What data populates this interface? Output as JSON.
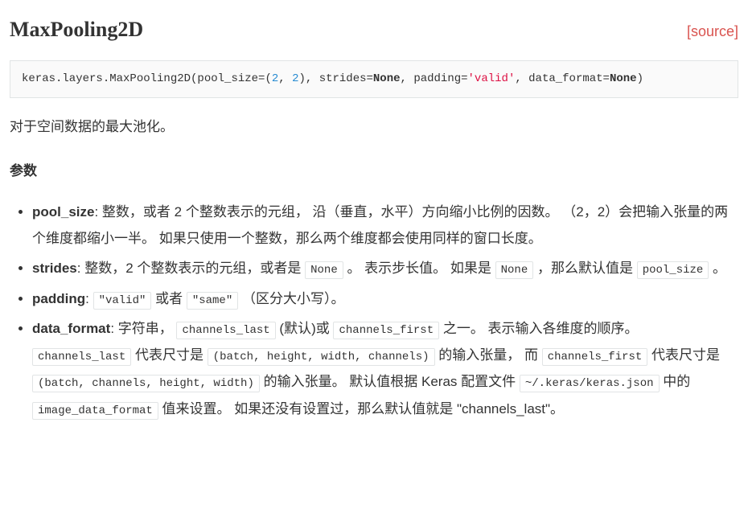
{
  "header": {
    "title": "MaxPooling2D",
    "source_label": "[source]"
  },
  "signature": {
    "prefix": "keras.layers.MaxPooling2D(pool_size=(",
    "num1": "2",
    "comma1": ", ",
    "num2": "2",
    "after_pool": "), strides=",
    "none1": "None",
    "after_strides": ", padding=",
    "valid": "'valid'",
    "after_padding": ", data_format=",
    "none2": "None",
    "close": ")"
  },
  "description": "对于空间数据的最大池化。",
  "section_title": "参数",
  "args": {
    "pool_size": {
      "name": "pool_size",
      "text": ": 整数，或者 2 个整数表示的元组， 沿（垂直，水平）方向缩小比例的因数。 （2，2）会把输入张量的两个维度都缩小一半。 如果只使用一个整数，那么两个维度都会使用同样的窗口长度。"
    },
    "strides": {
      "name": "strides",
      "t1": ": 整数，2 个整数表示的元组，或者是 ",
      "c1": "None",
      "t2": " 。 表示步长值。 如果是 ",
      "c2": "None",
      "t3": " ，那么默认值是 ",
      "c3": "pool_size",
      "t4": " 。"
    },
    "padding": {
      "name": "padding",
      "t1": ": ",
      "c1": "\"valid\"",
      "t2": " 或者 ",
      "c2": "\"same\"",
      "t3": " （区分大小写）。"
    },
    "data_format": {
      "name": "data_format",
      "t1": ": 字符串， ",
      "c1": "channels_last",
      "t2": " (默认)或 ",
      "c2": "channels_first",
      "t3": " 之一。 表示输入各维度的顺序。 ",
      "c3": "channels_last",
      "t4": " 代表尺寸是 ",
      "c4": "(batch, height, width, channels)",
      "t5": " 的输入张量， 而 ",
      "c5": "channels_first",
      "t6": " 代表尺寸是 ",
      "c6": "(batch, channels, height, width)",
      "t7": " 的输入张量。 默认值根据 Keras 配置文件 ",
      "c7": "~/.keras/keras.json",
      "t8": " 中的 ",
      "c8": "image_data_format",
      "t9": " 值来设置。 如果还没有设置过，那么默认值就是 \"channels_last\"。"
    }
  }
}
